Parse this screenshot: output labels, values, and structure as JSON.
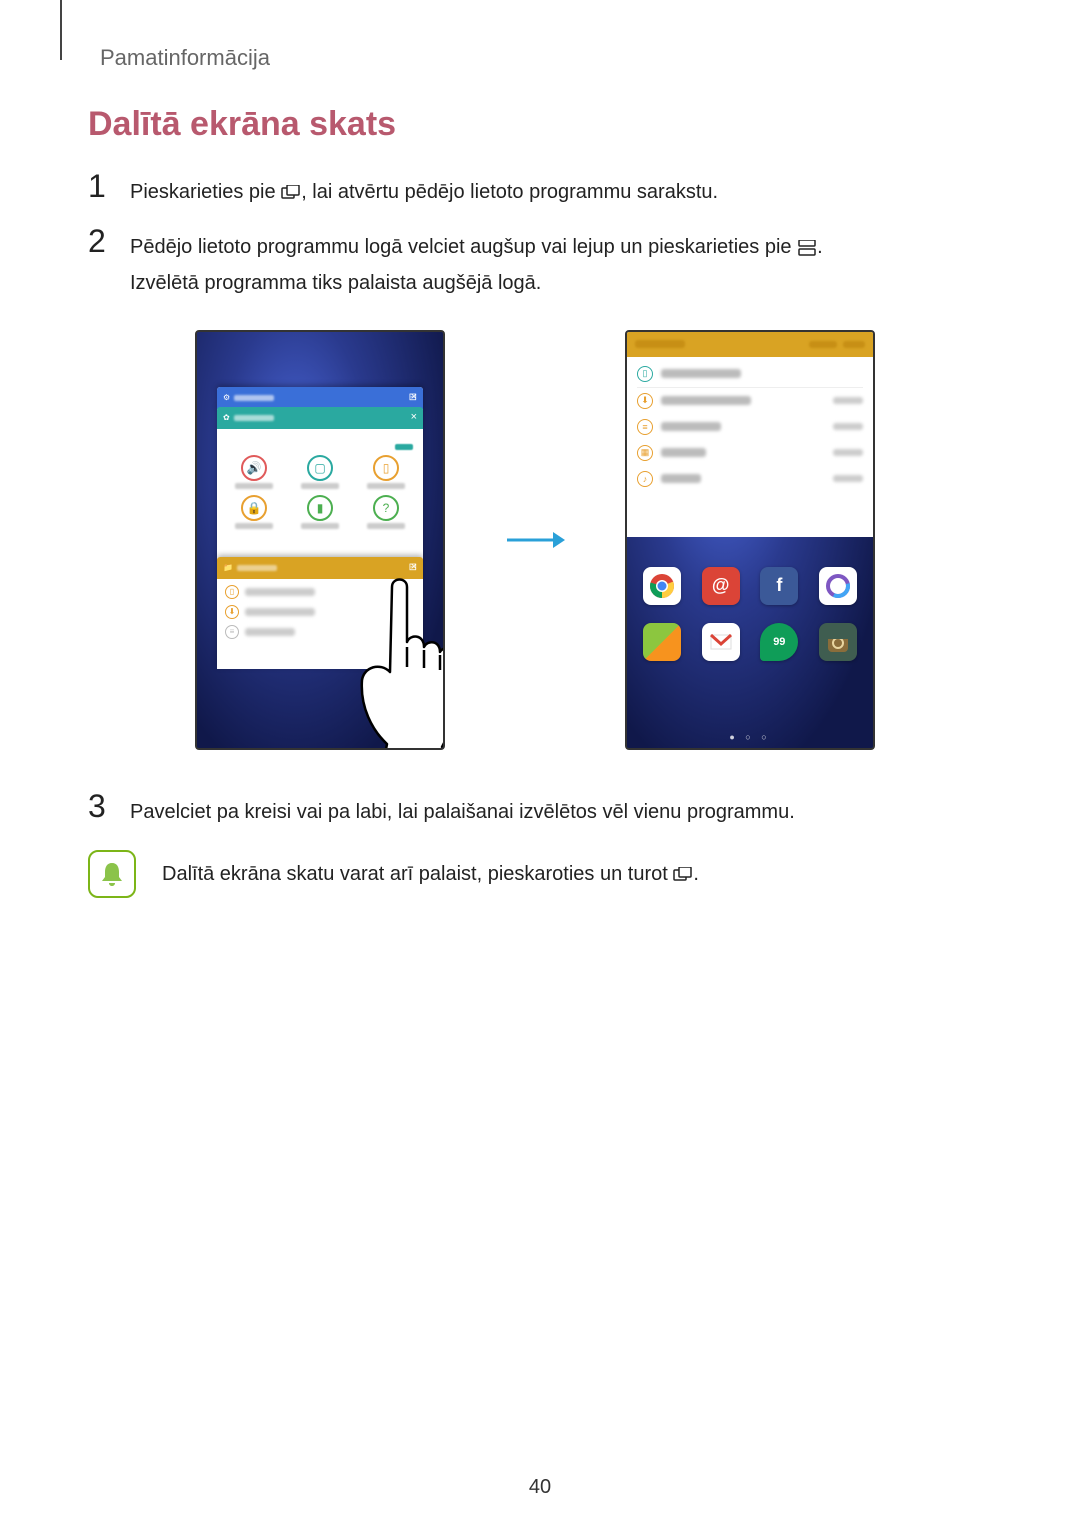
{
  "header": "Pamatinformācija",
  "title": "Dalītā ekrāna skats",
  "step1": {
    "num": "1",
    "text_a": "Pieskarieties pie ",
    "text_b": ", lai atvērtu pēdējo lietoto programmu sarakstu."
  },
  "step2": {
    "num": "2",
    "text_a": "Pēdējo lietoto programmu logā velciet augšup vai lejup un pieskarieties pie ",
    "text_b": ".",
    "text_c": "Izvēlētā programma tiks palaista augšējā logā."
  },
  "step3": {
    "num": "3",
    "text": "Pavelciet pa kreisi vai pa labi, lai palaišanai izvēlētos vēl vienu programmu."
  },
  "note": {
    "text_a": "Dalītā ekrāna skatu varat arī palaist, pieskaroties un turot ",
    "text_b": "."
  },
  "page_number": "40",
  "figure": {
    "left_phone": {
      "recent_cards": [
        "Internet",
        "Settings",
        "My Files"
      ]
    },
    "right_phone": {
      "file_top_header": "My Files"
    }
  }
}
